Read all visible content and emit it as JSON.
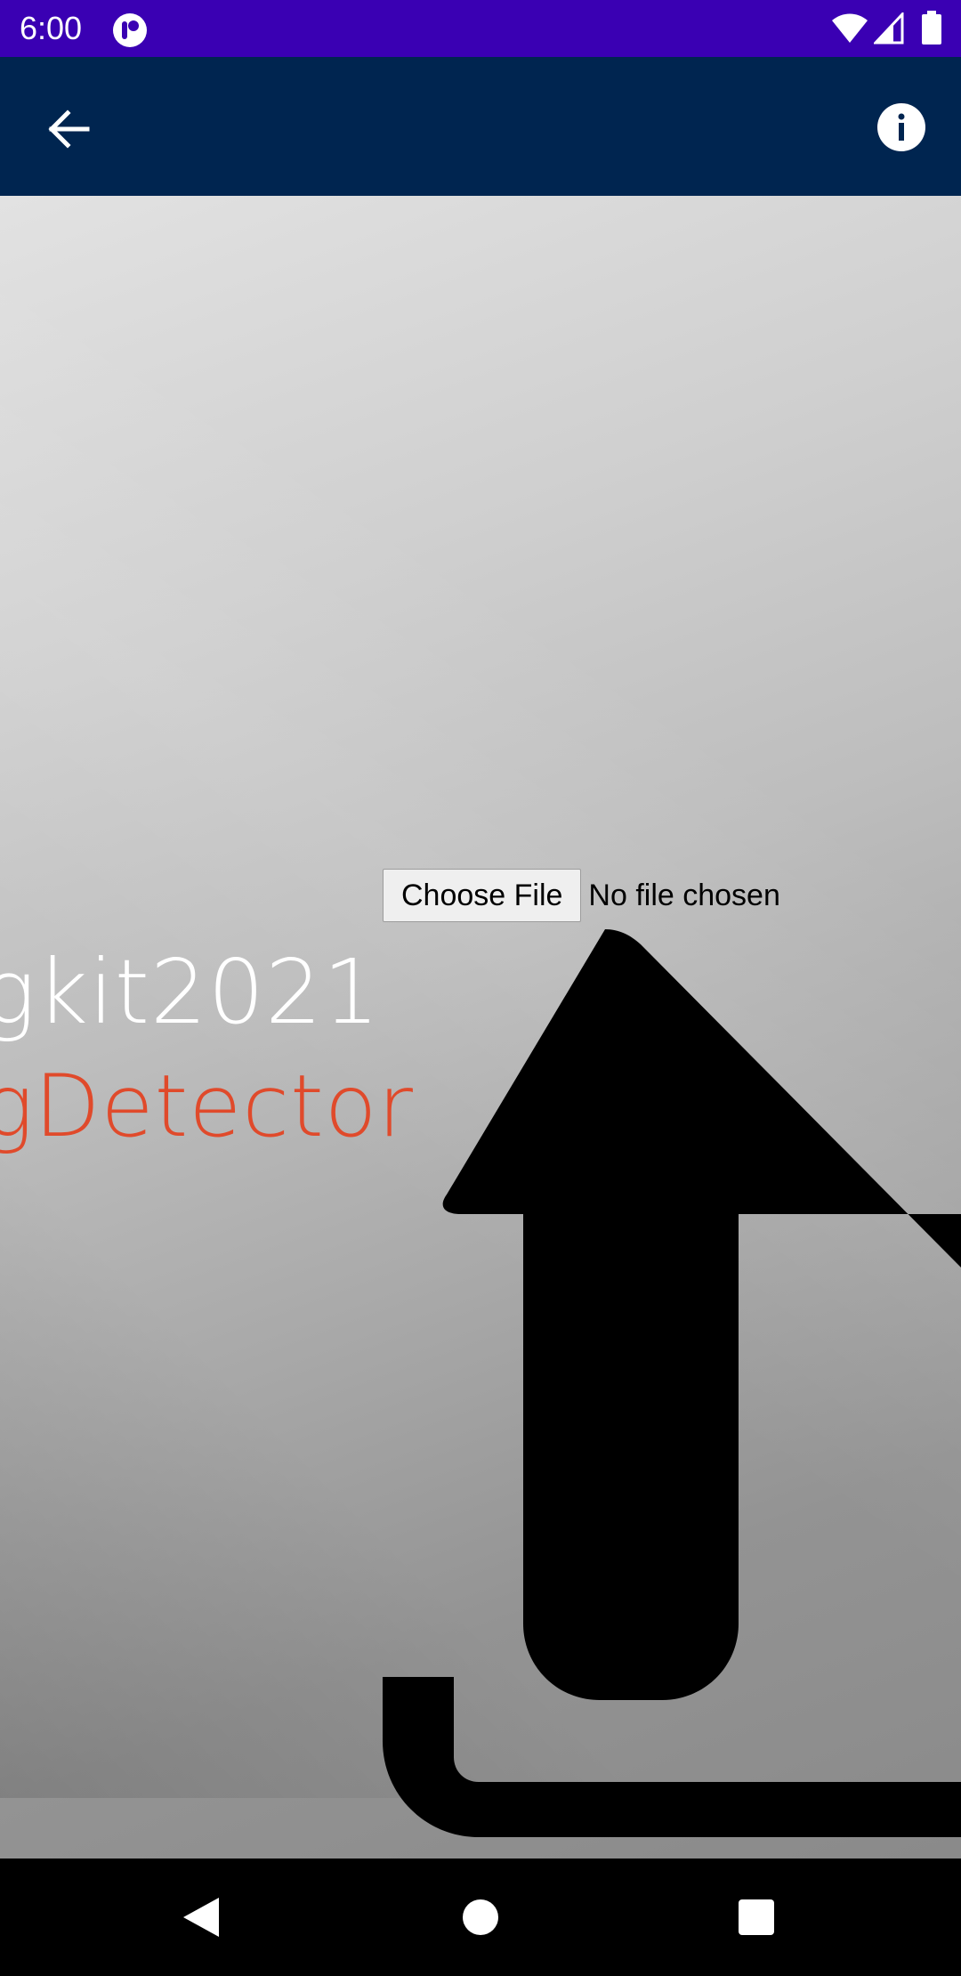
{
  "status_bar": {
    "time": "6:00",
    "icons": [
      "app-notification-icon",
      "wifi-icon",
      "signal-icon",
      "battery-icon"
    ],
    "background": "#3a00b3"
  },
  "app_bar": {
    "background": "#002550",
    "icons": [
      "back-arrow-icon",
      "info-icon"
    ]
  },
  "main": {
    "title_line_1": "gkit2021",
    "title_line_2": "gDetector",
    "title_line_2_color": "#e04a2b",
    "file_input": {
      "button_label": "Choose File",
      "status_text": "No file chosen"
    },
    "upload_icon": "upload-icon"
  },
  "nav_bar": {
    "icons": [
      "nav-back-icon",
      "nav-home-icon",
      "nav-recents-icon"
    ]
  }
}
